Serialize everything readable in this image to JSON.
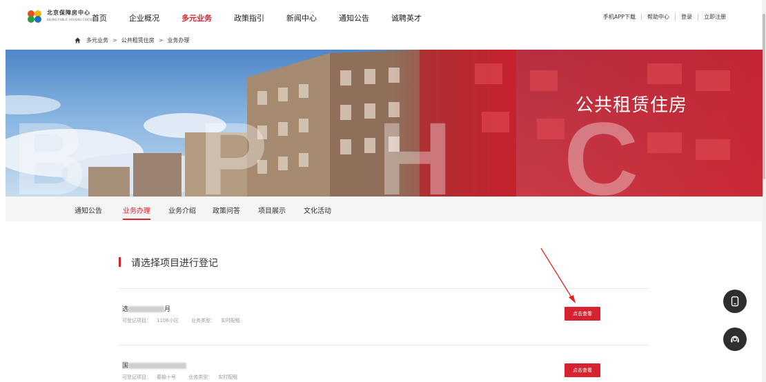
{
  "logo": {
    "cn": "北京保障房中心",
    "en": "BEIJING PUBLIC HOUSING CENTER"
  },
  "nav": [
    "首页",
    "企业概况",
    "多元业务",
    "政策指引",
    "新闻中心",
    "通知公告",
    "诚聘英才"
  ],
  "nav_active": "多元业务",
  "top_links": [
    "手机APP下载",
    "帮助中心",
    "登录",
    "立即注册"
  ],
  "breadcrumb": [
    "多元业务",
    "公共租赁住房",
    "业务办理"
  ],
  "banner": {
    "title": "公共租赁住房",
    "watermark": "B P H C"
  },
  "subnav": [
    "通知公告",
    "业务办理",
    "业务介绍",
    "政策问答",
    "项目展示",
    "文化活动"
  ],
  "subnav_active": "业务办理",
  "section_title": "请选择项目进行登记",
  "items": [
    {
      "title_prefix": "选",
      "title_suffix": "月",
      "project_label": "可登记项目：",
      "project": "1106小区",
      "type_label": "业务类型：",
      "type": "实时配租",
      "button": "点击查看"
    },
    {
      "title_prefix": "国",
      "title_suffix": "",
      "project_label": "可登记项目：",
      "project": "春榆十号",
      "type_label": "业务类型：",
      "type": "实时配租",
      "button": "点击查看"
    }
  ],
  "colors": {
    "brand_red": "#d6232f"
  }
}
